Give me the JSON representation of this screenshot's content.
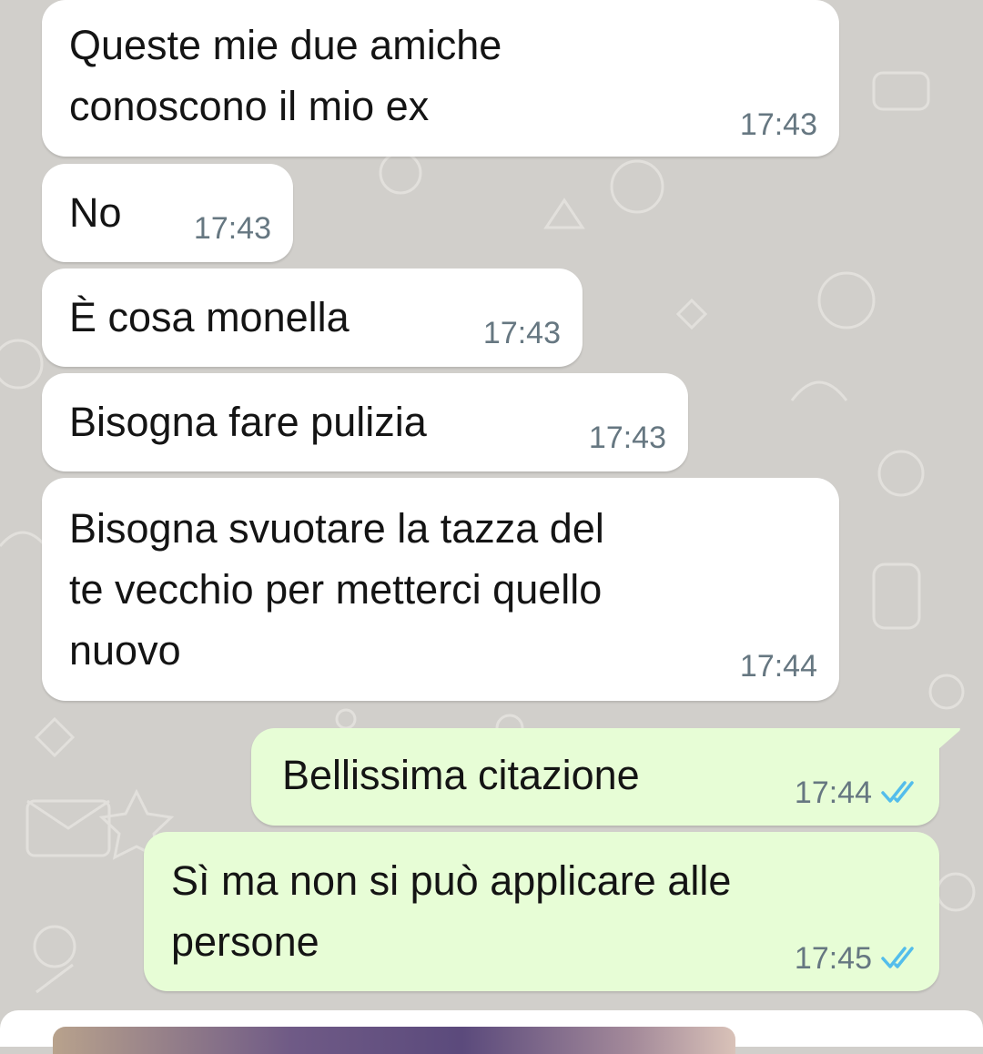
{
  "colors": {
    "background": "#d1cfcb",
    "incoming_bubble": "#ffffff",
    "outgoing_bubble": "#e7fdd6",
    "text": "#141414",
    "timestamp": "#667781",
    "read_ticks": "#53bdeb"
  },
  "messages": [
    {
      "direction": "incoming",
      "text": "Queste mie due amiche\nconoscono il mio ex",
      "time": "17:43"
    },
    {
      "direction": "incoming",
      "text": "No",
      "time": "17:43"
    },
    {
      "direction": "incoming",
      "text": "È cosa monella",
      "time": "17:43"
    },
    {
      "direction": "incoming",
      "text": "Bisogna fare pulizia",
      "time": "17:43"
    },
    {
      "direction": "incoming",
      "text": "Bisogna svuotare la tazza del\nte vecchio per metterci quello\nnuovo",
      "time": "17:44"
    },
    {
      "direction": "outgoing",
      "text": "Bellissima citazione",
      "time": "17:44",
      "status_icon": "double-check-read-icon"
    },
    {
      "direction": "outgoing",
      "text": "Sì ma non si può applicare alle\npersone",
      "time": "17:45",
      "status_icon": "double-check-read-icon"
    }
  ]
}
